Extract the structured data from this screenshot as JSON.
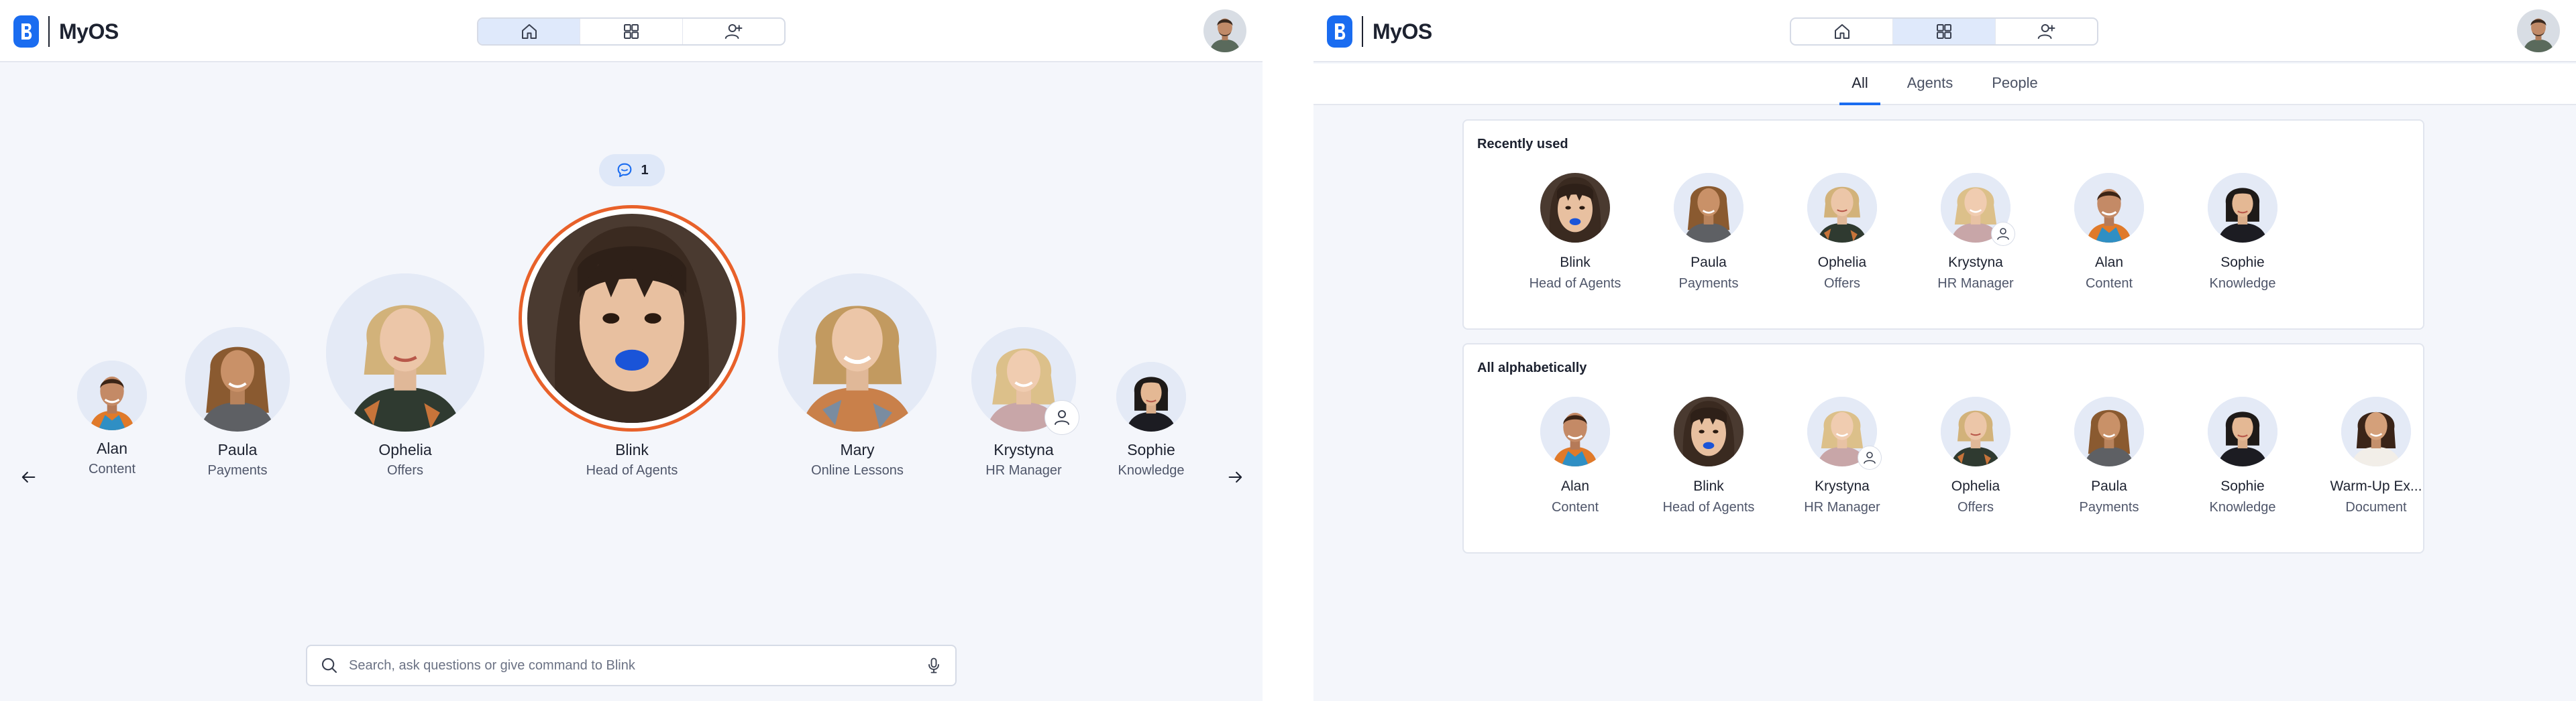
{
  "colors": {
    "accent": "#1a6cf0",
    "highlight_ring": "#e8612a",
    "avatar_bg": "#dfe8f8"
  },
  "app": {
    "name": "MyOS"
  },
  "nav": {
    "home_icon": "home-icon",
    "apps_icon": "grid-icon",
    "people_icon": "person-icon"
  },
  "home": {
    "chat_count": "1",
    "carousel": [
      {
        "name": "Alan",
        "role": "Content"
      },
      {
        "name": "Paula",
        "role": "Payments"
      },
      {
        "name": "Ophelia",
        "role": "Offers"
      },
      {
        "name": "Blink",
        "role": "Head of Agents"
      },
      {
        "name": "Mary",
        "role": "Online Lessons"
      },
      {
        "name": "Krystyna",
        "role": "HR Manager"
      },
      {
        "name": "Sophie",
        "role": "Knowledge"
      }
    ],
    "search_placeholder": "Search, ask questions or give command to Blink"
  },
  "directory": {
    "tabs": [
      "All",
      "Agents",
      "People"
    ],
    "recent_title": "Recently used",
    "recent": [
      {
        "name": "Blink",
        "role": "Head of Agents"
      },
      {
        "name": "Paula",
        "role": "Payments"
      },
      {
        "name": "Ophelia",
        "role": "Offers"
      },
      {
        "name": "Krystyna",
        "role": "HR Manager"
      },
      {
        "name": "Alan",
        "role": "Content"
      },
      {
        "name": "Sophie",
        "role": "Knowledge"
      }
    ],
    "alpha_title": "All alphabetically",
    "alpha": [
      {
        "name": "Alan",
        "role": "Content"
      },
      {
        "name": "Blink",
        "role": "Head of Agents"
      },
      {
        "name": "Krystyna",
        "role": "HR Manager"
      },
      {
        "name": "Ophelia",
        "role": "Offers"
      },
      {
        "name": "Paula",
        "role": "Payments"
      },
      {
        "name": "Sophie",
        "role": "Knowledge"
      },
      {
        "name": "Warm-Up Ex...",
        "role": "Document"
      }
    ]
  }
}
